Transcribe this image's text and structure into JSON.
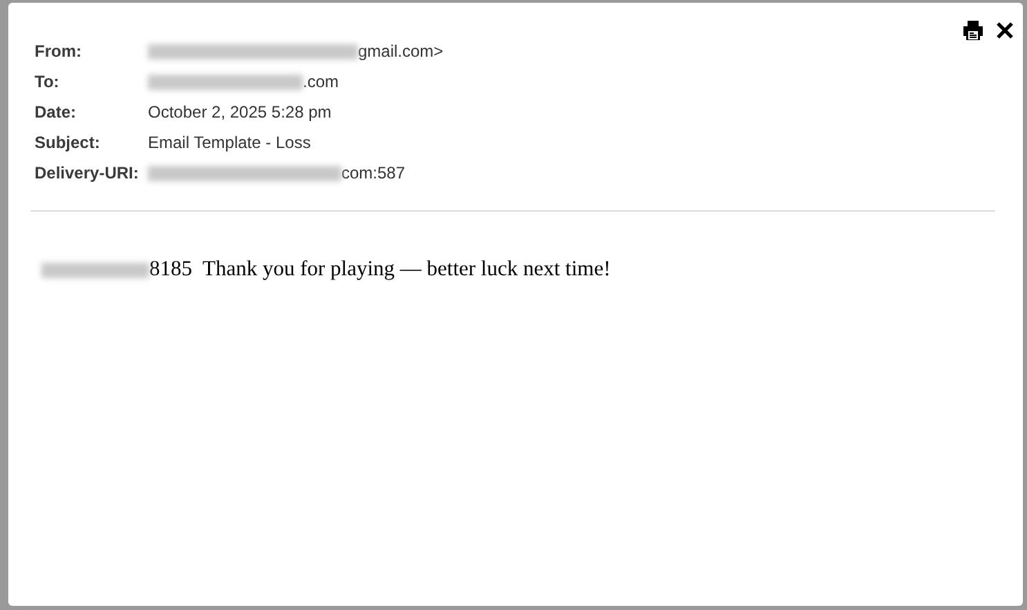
{
  "headers": [
    {
      "label": "From:",
      "value": "gmail.com>",
      "redacted_prefix": true
    },
    {
      "label": "To:",
      "value": ".com",
      "redacted_prefix": true
    },
    {
      "label": "Date:",
      "value": "October 2, 2025 5:28 pm",
      "redacted_prefix": false
    },
    {
      "label": "Subject:",
      "value": "Email Template - Loss",
      "redacted_prefix": false
    },
    {
      "label": "Delivery-URI:",
      "value": "com:587",
      "redacted_prefix": true
    }
  ],
  "body": {
    "text": "8185  Thank you for playing — better luck next time!",
    "redacted_prefix": true
  }
}
